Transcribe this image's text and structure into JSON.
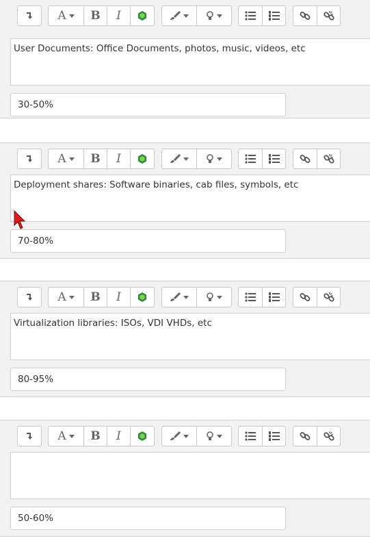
{
  "entries": [
    {
      "editor_text": "User Documents: Office Documents, photos, music, videos, etc",
      "percent_value": "30-50%"
    },
    {
      "editor_text": "Deployment shares: Software binaries, cab files, symbols, etc",
      "percent_value": "70-80%"
    },
    {
      "editor_text": "Virtualization libraries: ISOs, VDI VHDs, etc",
      "percent_value": "80-95%"
    },
    {
      "editor_text": "",
      "percent_value": "50-60%"
    }
  ],
  "toolbar": {
    "font_button_label": "A",
    "bold_label": "B",
    "italic_label": "I",
    "icons": [
      "toggle-toolbar-icon",
      "font-family-icon",
      "bold-icon",
      "italic-icon",
      "media-icon",
      "brush-icon",
      "lightbulb-icon",
      "bullet-list-icon",
      "numbered-list-icon",
      "link-icon",
      "unlink-icon"
    ]
  },
  "colors": {
    "media_icon": "#2e8b3a",
    "panel_bg": "#f2f2f2"
  }
}
